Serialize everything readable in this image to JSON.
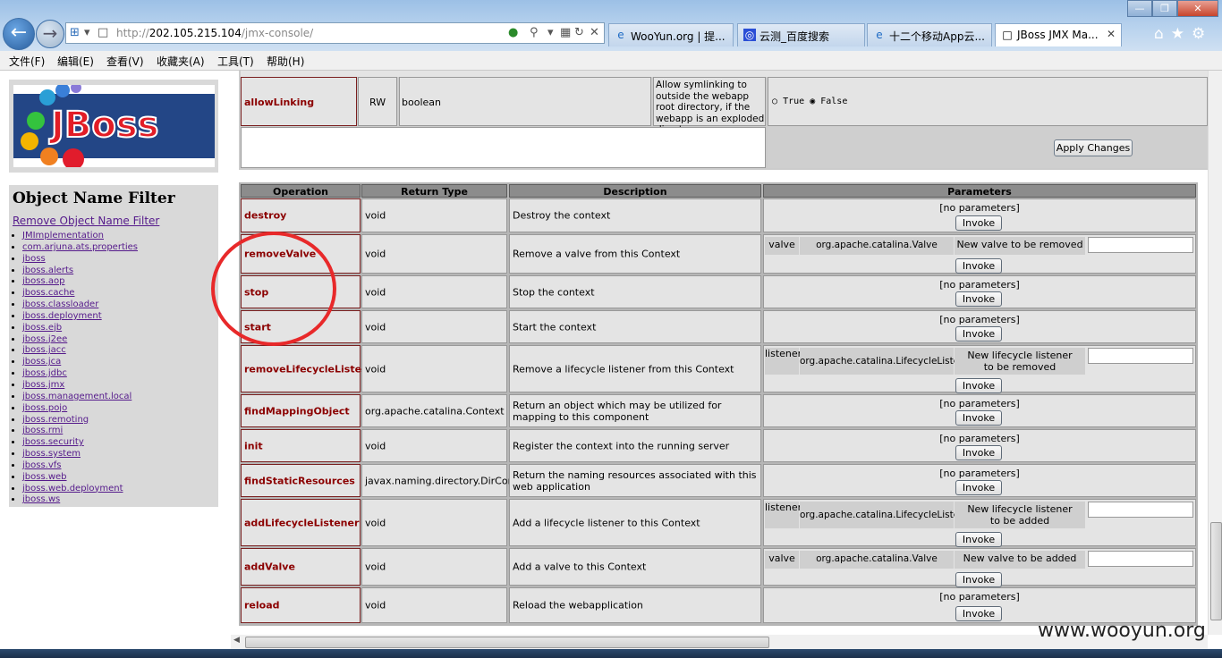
{
  "browser": {
    "address_prefix": "http://",
    "address_host": "202.105.215.104",
    "address_path": "/jmx-console/",
    "tabs": [
      {
        "label": "WooYun.org | 提...",
        "icon": "e-icon"
      },
      {
        "label": "云测_百度搜索",
        "icon": "baidu-icon"
      },
      {
        "label": "十二个移动App云...",
        "icon": "e-icon"
      },
      {
        "label": "JBoss JMX Ma...",
        "icon": "page-icon",
        "active": true
      }
    ],
    "menu": [
      "文件(F)",
      "编辑(E)",
      "查看(V)",
      "收藏夹(A)",
      "工具(T)",
      "帮助(H)"
    ]
  },
  "sidebar": {
    "logo_text": "JBoss",
    "filter_title": "Object Name Filter",
    "remove_filter_label": "Remove Object Name Filter",
    "domains": [
      "JMImplementation",
      "com.arjuna.ats.properties",
      "jboss",
      "jboss.alerts",
      "jboss.aop",
      "jboss.cache",
      "jboss.classloader",
      "jboss.deployment",
      "jboss.ejb",
      "jboss.j2ee",
      "jboss.jacc",
      "jboss.jca",
      "jboss.jdbc",
      "jboss.jmx",
      "jboss.management.local",
      "jboss.pojo",
      "jboss.remoting",
      "jboss.rmi",
      "jboss.security",
      "jboss.system",
      "jboss.vfs",
      "jboss.web",
      "jboss.web.deployment",
      "jboss.ws"
    ]
  },
  "attribute": {
    "name": "allowLinking",
    "access": "RW",
    "type": "boolean",
    "description": "Allow symlinking to outside the webapp root directory, if the webapp is an exploded directory",
    "radio_true": "True",
    "radio_false": "False",
    "selected": "False",
    "apply_label": "Apply Changes"
  },
  "operations": {
    "headers": [
      "Operation",
      "Return Type",
      "Description",
      "Parameters"
    ],
    "invoke_label": "Invoke",
    "no_params": "[no parameters]",
    "rows": [
      {
        "name": "destroy",
        "return": "void",
        "desc": "Destroy the context"
      },
      {
        "name": "removeValve",
        "return": "void",
        "desc": "Remove a valve from this Context",
        "p_name": "valve",
        "p_type": "org.apache.catalina.Valve",
        "p_desc": "New valve to be removed"
      },
      {
        "name": "stop",
        "return": "void",
        "desc": "Stop the context"
      },
      {
        "name": "start",
        "return": "void",
        "desc": "Start the context"
      },
      {
        "name": "removeLifecycleListener",
        "return": "void",
        "desc": "Remove a lifecycle listener from this Context",
        "p_name": "listener",
        "p_type": "org.apache.catalina.LifecycleListener",
        "p_desc": "New lifecycle listener to be removed"
      },
      {
        "name": "findMappingObject",
        "return": "org.apache.catalina.Context",
        "desc": "Return an object which may be utilized for mapping to this component"
      },
      {
        "name": "init",
        "return": "void",
        "desc": "Register the context into the running server"
      },
      {
        "name": "findStaticResources",
        "return": "javax.naming.directory.DirContext",
        "desc": "Return the naming resources associated with this web application"
      },
      {
        "name": "addLifecycleListener",
        "return": "void",
        "desc": "Add a lifecycle listener to this Context",
        "p_name": "listener",
        "p_type": "org.apache.catalina.LifecycleListener",
        "p_desc": "New lifecycle listener to be added"
      },
      {
        "name": "addValve",
        "return": "void",
        "desc": "Add a valve to this Context",
        "p_name": "valve",
        "p_type": "org.apache.catalina.Valve",
        "p_desc": "New valve to be added"
      },
      {
        "name": "reload",
        "return": "void",
        "desc": "Reload the webapplication"
      }
    ]
  },
  "watermark": "www.wooyun.org"
}
